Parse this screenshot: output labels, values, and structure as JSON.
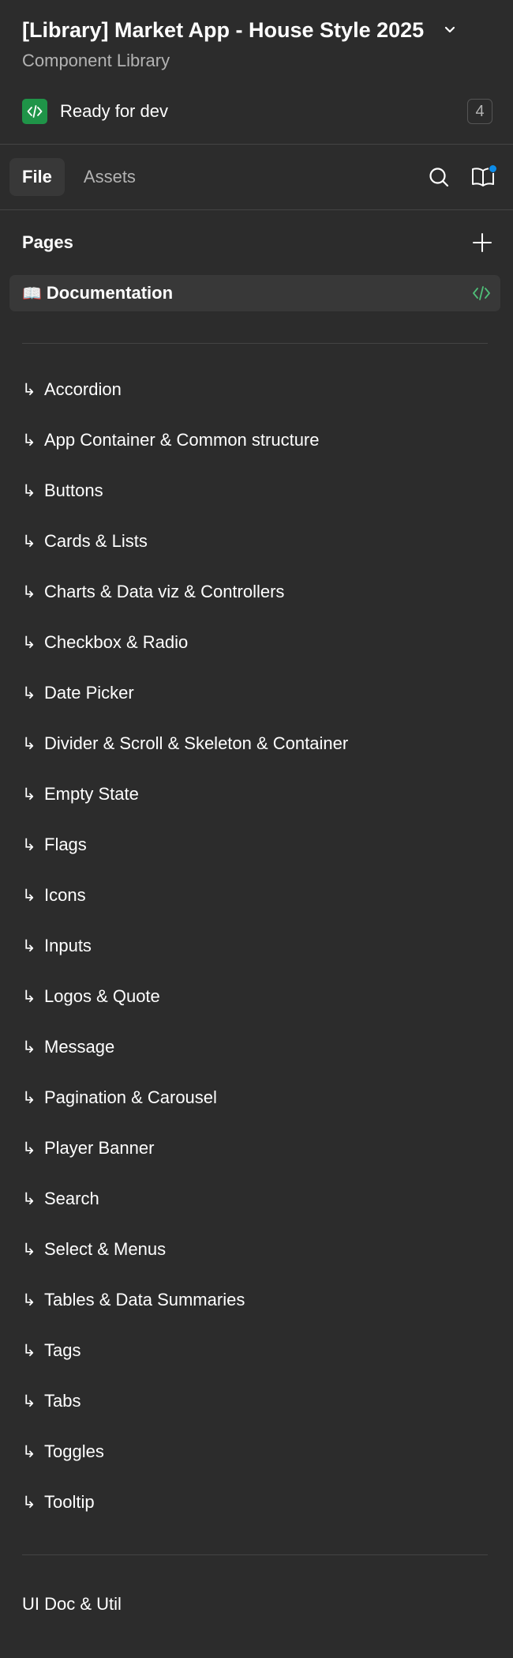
{
  "header": {
    "file_title": "[Library] Market App - House Style 2025",
    "subtitle": "Component Library",
    "status_label": "Ready for dev",
    "status_count": "4",
    "colors": {
      "dev_badge": "#1f9448",
      "notification": "#0c8ce9",
      "code_mark": "#4fbf78"
    }
  },
  "tabs": {
    "file": "File",
    "assets": "Assets",
    "icons": [
      "search-icon",
      "library-book-icon"
    ]
  },
  "pages": {
    "title": "Pages",
    "current": {
      "emoji": "📖",
      "label": "Documentation"
    },
    "arrow_glyph": "↳",
    "items": [
      "Accordion",
      "App Container & Common structure",
      "Buttons",
      "Cards & Lists",
      "Charts & Data viz & Controllers",
      "Checkbox & Radio",
      "Date Picker",
      "Divider & Scroll & Skeleton & Container",
      "Empty State",
      "Flags",
      "Icons",
      "Inputs",
      "Logos & Quote",
      "Message",
      "Pagination & Carousel",
      "Player Banner",
      "Search",
      "Select & Menus",
      "Tables & Data Summaries",
      "Tags",
      "Tabs",
      "Toggles",
      "Tooltip"
    ],
    "footer_item": "UI Doc & Util"
  }
}
